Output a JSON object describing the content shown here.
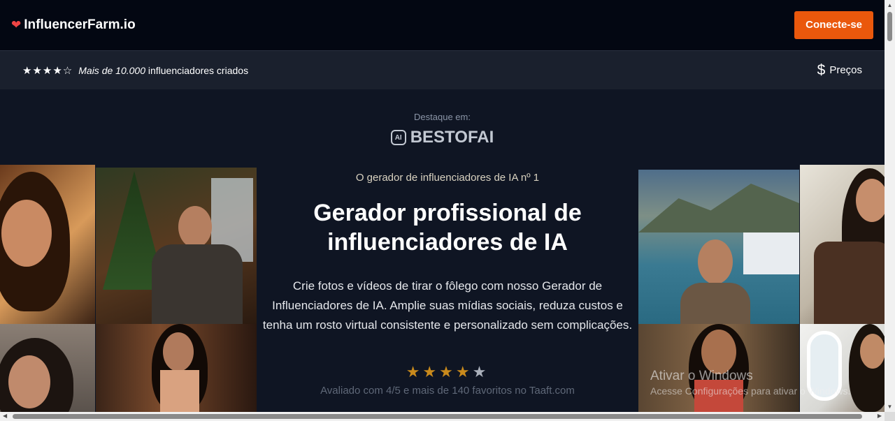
{
  "header": {
    "brand": "InfluencerFarm.io",
    "cta_label": "Conecte-se"
  },
  "subbar": {
    "stars": "★★★★☆",
    "rating_emphasis": "Mais de 10.000",
    "rating_rest": "influenciadores criados",
    "pricing_label": "Preços"
  },
  "hero": {
    "featured_label": "Destaque em:",
    "featured_logo_badge": "AI",
    "featured_logo_text": "BESTOFAI",
    "tagline": "O gerador de influenciadores de IA nº 1",
    "headline": "Gerador profissional de influenciadores de IA",
    "description": "Crie fotos e vídeos de tirar o fôlego com nosso Gerador de Influenciadores de IA. Amplie suas mídias sociais, reduza custos e tenha um rosto virtual consistente e personalizado sem complicações.",
    "stars_on": "★★★★",
    "stars_off": "★",
    "rated_text": "Avaliado com 4/5 e mais de 140 favoritos no Taaft.com",
    "rating_value": 4,
    "rating_max": 5
  },
  "watermark": {
    "line1": "Ativar o Windows",
    "line2": "Acesse Configurações para ativar o Windows."
  },
  "colors": {
    "accent": "#ea580c",
    "heart": "#ef4444",
    "star": "#c98a1c"
  },
  "icons": {
    "brand": "heart-icon",
    "pricing": "dollar-icon",
    "logo": "ai-badge-icon"
  }
}
